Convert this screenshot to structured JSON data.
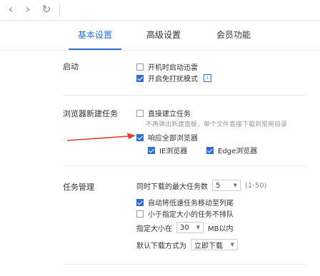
{
  "toolbar": {
    "back_icon": "chevron-left-icon",
    "forward_icon": "chevron-right-icon",
    "refresh_icon": "refresh-icon"
  },
  "tabs": [
    {
      "label": "基本设置",
      "active": true
    },
    {
      "label": "高级设置",
      "active": false
    },
    {
      "label": "会员功能",
      "active": false
    }
  ],
  "startup": {
    "title": "启动",
    "options": [
      {
        "label": "开机时启动迅雷",
        "checked": false
      },
      {
        "label": "开启免打扰模式",
        "checked": true
      }
    ]
  },
  "browser_task": {
    "title": "浏览器新建任务",
    "direct": {
      "label": "直接建立任务",
      "checked": false
    },
    "direct_hint": "不再弹出新建面板，单个文件直接下载到常用目录",
    "respond_all": {
      "label": "响应全部浏览器",
      "checked": true
    },
    "ie": {
      "label": "IE浏览器",
      "checked": true
    },
    "edge": {
      "label": "Edge浏览器",
      "checked": true
    }
  },
  "task_mgmt": {
    "title": "任务管理",
    "max_tasks_label": "同时下载的最大任务数",
    "max_tasks_value": "5",
    "max_tasks_range": "(1-50)",
    "auto_move": {
      "label": "自动将低速任务移动至列尾",
      "checked": true
    },
    "no_queue": {
      "label": "小于指定大小的任务不排队",
      "checked": false
    },
    "size_label": "指定大小在",
    "size_value": "30",
    "size_unit": "MB以内",
    "default_mode_label": "默认下载方式为",
    "default_mode_value": "立即下载"
  },
  "colors": {
    "accent": "#2d6fd6",
    "arrow": "#e03a2f"
  }
}
